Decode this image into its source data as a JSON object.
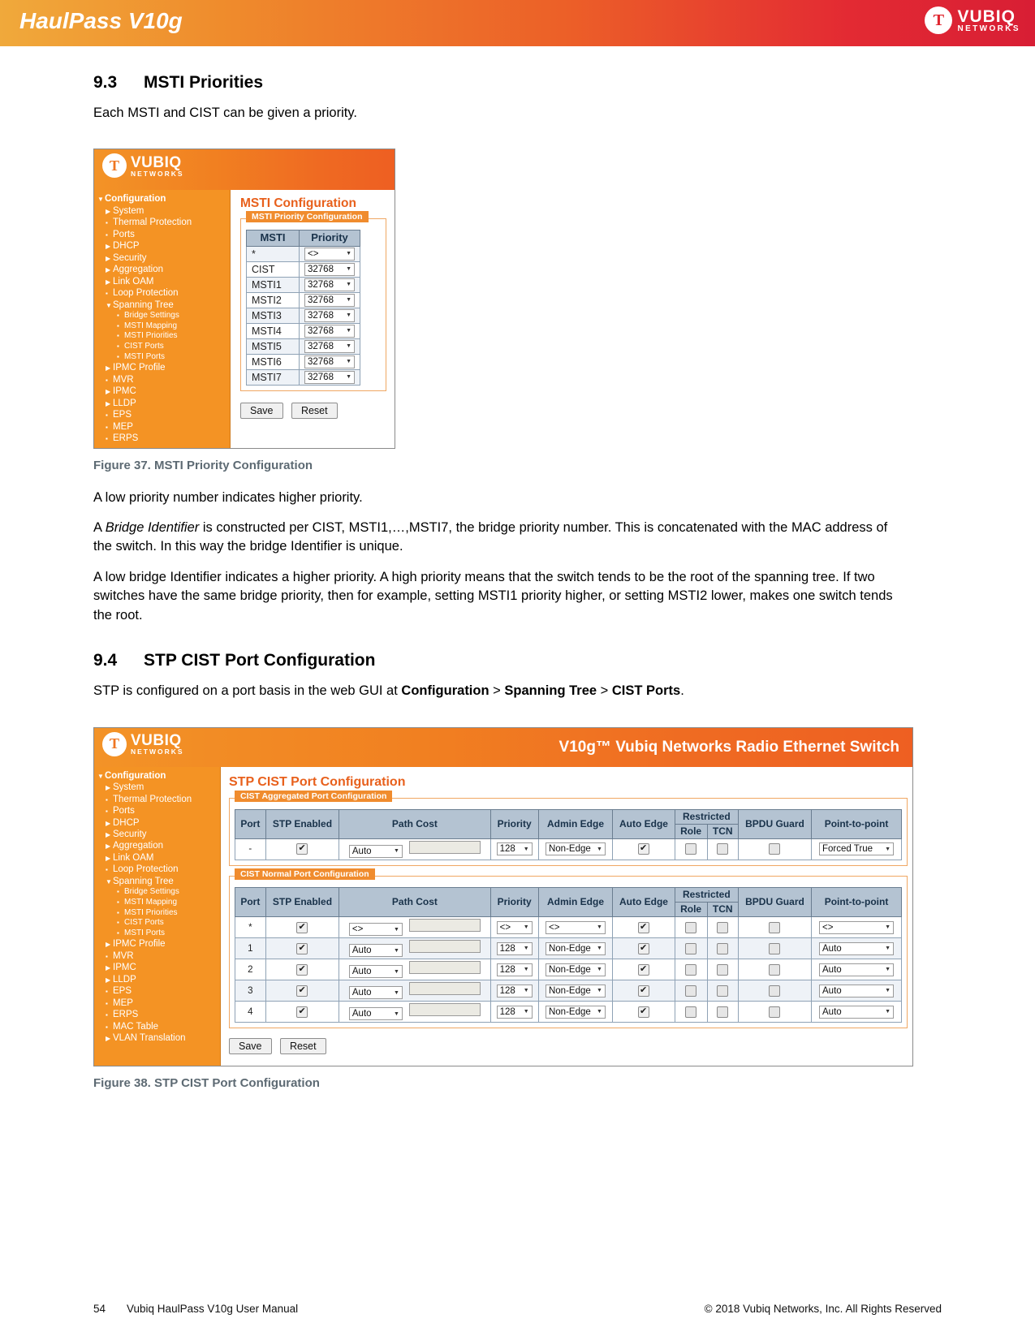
{
  "header": {
    "product_title": "HaulPass V10g",
    "logo": {
      "mark": "Ƭ",
      "word_top": "VUBIQ",
      "word_bottom": "NETWORKS"
    }
  },
  "sections": [
    {
      "number": "9.3",
      "title": "MSTI Priorities",
      "intro": "Each MSTI and CIST can be given a priority."
    },
    {
      "number": "9.4",
      "title": "STP CIST Port Configuration"
    }
  ],
  "paragraphs": {
    "after_fig37_1": "A low priority number indicates higher priority.",
    "after_fig37_2_a": "A ",
    "after_fig37_2_em": "Bridge Identifier",
    "after_fig37_2_b": " is constructed per CIST, MSTI1,…,MSTI7, the bridge priority number. This is concatenated with the MAC address of the switch. In this way the bridge Identifier is unique.",
    "after_fig37_3": "A low bridge Identifier indicates a higher priority. A high priority means that the switch tends to be the root of the spanning tree. If two switches have the same bridge priority, then for example, setting MSTI1 priority higher, or setting MSTI2 lower, makes one switch tends the root.",
    "sec94_intro_a": "STP is configured on a port basis in the web GUI at ",
    "sec94_intro_b1": "Configuration",
    "sec94_intro_gt1": " > ",
    "sec94_intro_b2": "Spanning Tree",
    "sec94_intro_gt2": " > ",
    "sec94_intro_b3": "CIST Ports",
    "sec94_intro_end": "."
  },
  "captions": {
    "fig37": "Figure 37. MSTI Priority Configuration",
    "fig38": "Figure 38. STP CIST Port Configuration"
  },
  "gui_nav": {
    "items": [
      {
        "label": "Configuration",
        "level": 0,
        "marker": "▼"
      },
      {
        "label": "System",
        "level": 1,
        "marker": "▶"
      },
      {
        "label": "Thermal Protection",
        "level": 1,
        "marker": "▪"
      },
      {
        "label": "Ports",
        "level": 1,
        "marker": "▪"
      },
      {
        "label": "DHCP",
        "level": 1,
        "marker": "▶"
      },
      {
        "label": "Security",
        "level": 1,
        "marker": "▶"
      },
      {
        "label": "Aggregation",
        "level": 1,
        "marker": "▶"
      },
      {
        "label": "Link OAM",
        "level": 1,
        "marker": "▶"
      },
      {
        "label": "Loop Protection",
        "level": 1,
        "marker": "▪"
      },
      {
        "label": "Spanning Tree",
        "level": 1,
        "marker": "▼"
      },
      {
        "label": "Bridge Settings",
        "level": 2,
        "marker": "▪"
      },
      {
        "label": "MSTI Mapping",
        "level": 2,
        "marker": "▪"
      },
      {
        "label": "MSTI Priorities",
        "level": 2,
        "marker": "▪"
      },
      {
        "label": "CIST Ports",
        "level": 2,
        "marker": "▪"
      },
      {
        "label": "MSTI Ports",
        "level": 2,
        "marker": "▪"
      },
      {
        "label": "IPMC Profile",
        "level": 1,
        "marker": "▶"
      },
      {
        "label": "MVR",
        "level": 1,
        "marker": "▪"
      },
      {
        "label": "IPMC",
        "level": 1,
        "marker": "▶"
      },
      {
        "label": "LLDP",
        "level": 1,
        "marker": "▶"
      },
      {
        "label": "EPS",
        "level": 1,
        "marker": "▪"
      },
      {
        "label": "MEP",
        "level": 1,
        "marker": "▪"
      },
      {
        "label": "ERPS",
        "level": 1,
        "marker": "▪"
      },
      {
        "label": "MAC Table",
        "level": 1,
        "marker": "▪"
      },
      {
        "label": "VLAN Translation",
        "level": 1,
        "marker": "▶"
      }
    ],
    "fig37_visible_count": 22,
    "fig38_visible_count": 24
  },
  "fig37": {
    "page_title": "MSTI Configuration",
    "fieldset_legend": "MSTI Priority Configuration",
    "columns": [
      "MSTI",
      "Priority"
    ],
    "rows": [
      {
        "msti": "*",
        "priority": "<>"
      },
      {
        "msti": "CIST",
        "priority": "32768"
      },
      {
        "msti": "MSTI1",
        "priority": "32768"
      },
      {
        "msti": "MSTI2",
        "priority": "32768"
      },
      {
        "msti": "MSTI3",
        "priority": "32768"
      },
      {
        "msti": "MSTI4",
        "priority": "32768"
      },
      {
        "msti": "MSTI5",
        "priority": "32768"
      },
      {
        "msti": "MSTI6",
        "priority": "32768"
      },
      {
        "msti": "MSTI7",
        "priority": "32768"
      }
    ],
    "save_label": "Save",
    "reset_label": "Reset"
  },
  "fig38": {
    "top_banner_title": "V10g™ Vubiq Networks Radio Ethernet Switch",
    "page_title": "STP CIST Port Configuration",
    "aggregated": {
      "legend": "CIST Aggregated Port Configuration",
      "columns": {
        "port": "Port",
        "stp_enabled": "STP Enabled",
        "path_cost": "Path Cost",
        "priority": "Priority",
        "admin_edge": "Admin Edge",
        "auto_edge": "Auto Edge",
        "restricted": "Restricted",
        "restricted_role": "Role",
        "restricted_tcn": "TCN",
        "bpdu_guard": "BPDU Guard",
        "point_to_point": "Point-to-point"
      },
      "rows": [
        {
          "port": "-",
          "stp_enabled": true,
          "path_cost": "Auto",
          "path_cost_value": "",
          "priority": "128",
          "admin_edge": "Non-Edge",
          "auto_edge": true,
          "restricted_role": false,
          "restricted_tcn": false,
          "bpdu_guard": false,
          "point_to_point": "Forced True"
        }
      ]
    },
    "normal": {
      "legend": "CIST Normal Port Configuration",
      "columns": {
        "port": "Port",
        "stp_enabled": "STP Enabled",
        "path_cost": "Path Cost",
        "priority": "Priority",
        "admin_edge": "Admin Edge",
        "auto_edge": "Auto Edge",
        "restricted": "Restricted",
        "restricted_role": "Role",
        "restricted_tcn": "TCN",
        "bpdu_guard": "BPDU Guard",
        "point_to_point": "Point-to-point"
      },
      "rows": [
        {
          "port": "*",
          "stp_enabled": true,
          "path_cost": "<>",
          "path_cost_value": "",
          "priority": "<>",
          "admin_edge": "<>",
          "auto_edge": true,
          "restricted_role": false,
          "restricted_tcn": false,
          "bpdu_guard": false,
          "point_to_point": "<>"
        },
        {
          "port": "1",
          "stp_enabled": true,
          "path_cost": "Auto",
          "path_cost_value": "",
          "priority": "128",
          "admin_edge": "Non-Edge",
          "auto_edge": true,
          "restricted_role": false,
          "restricted_tcn": false,
          "bpdu_guard": false,
          "point_to_point": "Auto"
        },
        {
          "port": "2",
          "stp_enabled": true,
          "path_cost": "Auto",
          "path_cost_value": "",
          "priority": "128",
          "admin_edge": "Non-Edge",
          "auto_edge": true,
          "restricted_role": false,
          "restricted_tcn": false,
          "bpdu_guard": false,
          "point_to_point": "Auto"
        },
        {
          "port": "3",
          "stp_enabled": true,
          "path_cost": "Auto",
          "path_cost_value": "",
          "priority": "128",
          "admin_edge": "Non-Edge",
          "auto_edge": true,
          "restricted_role": false,
          "restricted_tcn": false,
          "bpdu_guard": false,
          "point_to_point": "Auto"
        },
        {
          "port": "4",
          "stp_enabled": true,
          "path_cost": "Auto",
          "path_cost_value": "",
          "priority": "128",
          "admin_edge": "Non-Edge",
          "auto_edge": true,
          "restricted_role": false,
          "restricted_tcn": false,
          "bpdu_guard": false,
          "point_to_point": "Auto"
        }
      ]
    },
    "save_label": "Save",
    "reset_label": "Reset"
  },
  "footer": {
    "page_number": "54",
    "doc_title": "Vubiq HaulPass V10g User Manual",
    "copyright": "© 2018 Vubiq Networks, Inc. All Rights Reserved"
  },
  "colors": {
    "banner_left": "#f0a93b",
    "banner_right": "#d81e34",
    "gui_orange": "#f49324",
    "gui_title_orange": "#e8601c",
    "legend_orange": "#f08c2e",
    "table_header": "#b4c3d2",
    "caption_gray": "#5d6a73"
  }
}
